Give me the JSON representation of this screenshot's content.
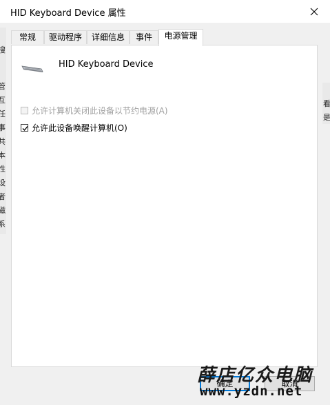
{
  "window": {
    "title": "HID Keyboard Device 属性"
  },
  "tabs": [
    {
      "label": "常规"
    },
    {
      "label": "驱动程序"
    },
    {
      "label": "详细信息"
    },
    {
      "label": "事件"
    },
    {
      "label": "电源管理",
      "active": true
    }
  ],
  "device": {
    "name": "HID Keyboard Device",
    "icon": "keyboard-icon"
  },
  "options": {
    "allow_power_off_label": "允许计算机关闭此设备以节约电源(A)",
    "allow_power_off_checked": false,
    "allow_power_off_enabled": false,
    "allow_wake_label": "允许此设备唤醒计算机(O)",
    "allow_wake_checked": true
  },
  "buttons": {
    "ok_label": "确定",
    "cancel_label": "取消"
  },
  "background_window": {
    "left_fragments": [
      "搜",
      "管",
      "互",
      "任",
      "事",
      "共",
      "本",
      "性",
      "设",
      "者",
      "磁",
      "系"
    ],
    "right_fragments": [
      "看",
      "是"
    ]
  },
  "watermark": {
    "text": "薛店亿众电脑",
    "url": "www.yzdn.net"
  }
}
